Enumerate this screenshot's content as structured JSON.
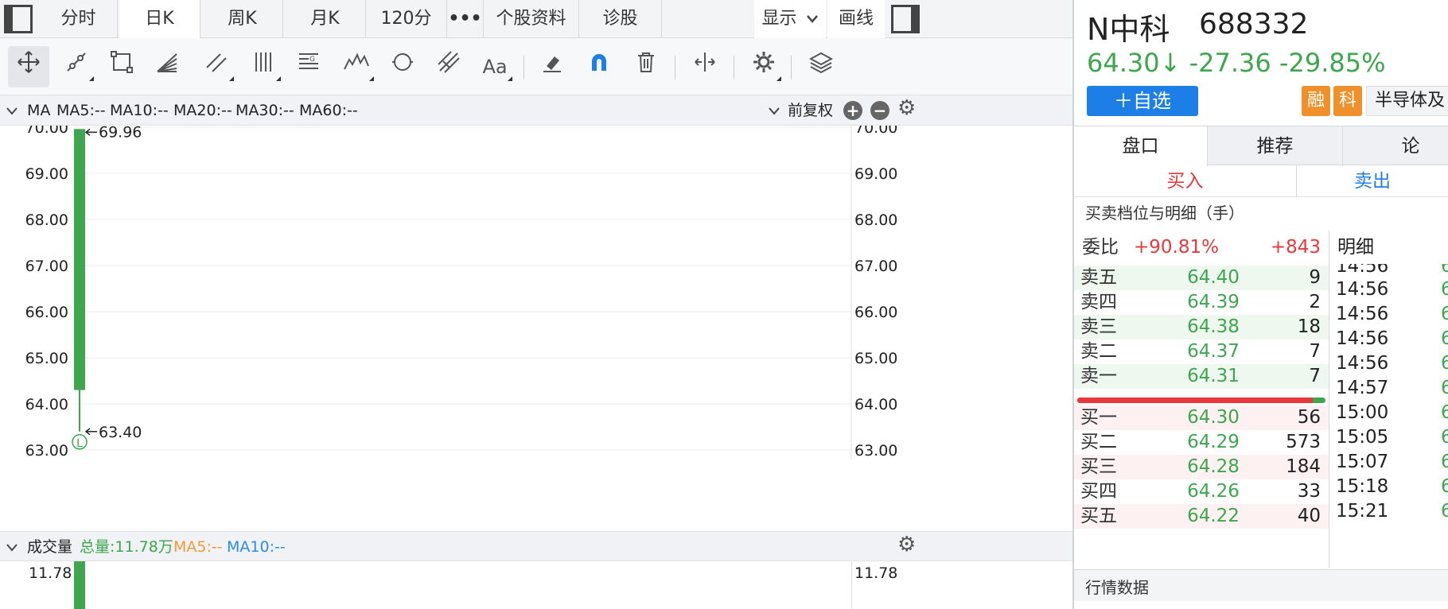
{
  "tabs": [
    {
      "label": "分时"
    },
    {
      "label": "日K"
    },
    {
      "label": "周K"
    },
    {
      "label": "月K"
    },
    {
      "label": "120分"
    },
    {
      "label": "•••"
    },
    {
      "label": "个股资料"
    },
    {
      "label": "诊股"
    }
  ],
  "active_tab": "日K",
  "display_dropdown": {
    "label": "显示",
    "icon": "chevron-down-icon"
  },
  "draw_label": "画线",
  "toolbar_icons": [
    "move-cross-icon",
    "line-segment-icon",
    "rectangle-icon",
    "fan-lines-icon",
    "parallel-channel-icon",
    "vertical-lines-icon",
    "gann-box-icon",
    "wave-icon",
    "cycle-icon",
    "pitchfork-icon",
    "text-icon",
    "eraser-icon",
    "magnet-icon",
    "trash-icon",
    "zoom-icon",
    "settings-icon",
    "layers-icon"
  ],
  "ma_bar": {
    "toggle": "MA",
    "items": [
      {
        "label": "MA5:--",
        "color": "#f29a38"
      },
      {
        "label": "MA10:--",
        "color": "#2b8de8"
      },
      {
        "label": "MA20:--",
        "color": "#b43ca8"
      },
      {
        "label": "MA30:--",
        "color": "#27c3d8"
      },
      {
        "label": "MA60:--",
        "color": "#e8632b"
      }
    ],
    "adjust_label": "前复权"
  },
  "price_axis": {
    "ticks": [
      "70.00",
      "69.00",
      "68.00",
      "67.00",
      "66.00",
      "65.00",
      "64.00",
      "63.00"
    ]
  },
  "candle_annotations": {
    "high_label": "69.96",
    "low_label": "63.40",
    "marker": "L"
  },
  "chart_data": {
    "type": "candlestick",
    "ylim": [
      63.0,
      70.0
    ],
    "candles": [
      {
        "open": 69.96,
        "high": 69.96,
        "low": 63.4,
        "close": 64.3
      }
    ],
    "colors": {
      "down": "#3ea64e"
    }
  },
  "volume_bar": {
    "toggle": "成交量",
    "total": "总量:11.78万",
    "ma5": "MA5:--",
    "ma10": "MA10:--",
    "axis_top": "11.78"
  },
  "stock": {
    "name": "N中科",
    "code": "688332",
    "price_change": "64.30↓ -27.36 -29.85%",
    "add_button": "＋自选",
    "tags": [
      "融",
      "科"
    ],
    "industry": "半导体及"
  },
  "panel_tabs": [
    "盘口",
    "推荐",
    "论"
  ],
  "buy_label": "买入",
  "sell_label": "卖出",
  "book_title": "买卖档位与明细（手）",
  "weibi": {
    "label": "委比",
    "pct": "+90.81%",
    "diff": "+843"
  },
  "detail_label": "明细",
  "order_book": {
    "sell": [
      {
        "label": "卖五",
        "price": "64.40",
        "volume": "9"
      },
      {
        "label": "卖四",
        "price": "64.39",
        "volume": "2"
      },
      {
        "label": "卖三",
        "price": "64.38",
        "volume": "18"
      },
      {
        "label": "卖二",
        "price": "64.37",
        "volume": "7"
      },
      {
        "label": "卖一",
        "price": "64.31",
        "volume": "7"
      }
    ],
    "buy": [
      {
        "label": "买一",
        "price": "64.30",
        "volume": "56"
      },
      {
        "label": "买二",
        "price": "64.29",
        "volume": "573"
      },
      {
        "label": "买三",
        "price": "64.28",
        "volume": "184"
      },
      {
        "label": "买四",
        "price": "64.26",
        "volume": "33"
      },
      {
        "label": "买五",
        "price": "64.22",
        "volume": "40"
      }
    ],
    "ratio_fraction": 0.95
  },
  "ticks": [
    {
      "time": "14:56",
      "price": "6"
    },
    {
      "time": "14:56",
      "price": "6"
    },
    {
      "time": "14:56",
      "price": "6"
    },
    {
      "time": "14:56",
      "price": "6"
    },
    {
      "time": "14:56",
      "price": "6"
    },
    {
      "time": "14:57",
      "price": "6"
    },
    {
      "time": "15:00",
      "price": "6"
    },
    {
      "time": "15:05",
      "price": "6"
    },
    {
      "time": "15:07",
      "price": "6"
    },
    {
      "time": "15:18",
      "price": "6"
    },
    {
      "time": "15:21",
      "price": "6"
    }
  ],
  "market_data_title": "行情数据"
}
